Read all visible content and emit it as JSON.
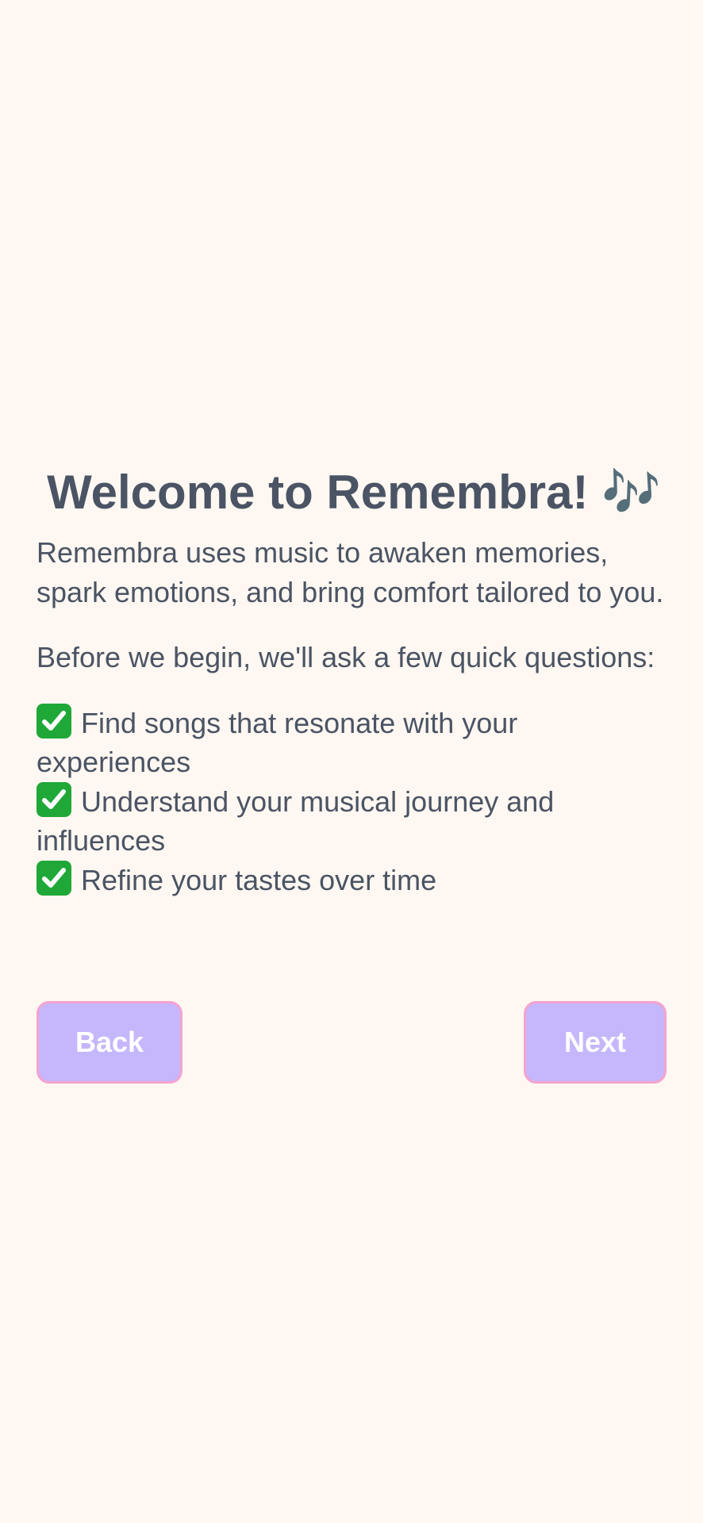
{
  "welcome": {
    "title": "Welcome to Remembra! 🎶",
    "intro": "Remembra uses music to awaken memories, spark emotions, and bring comfort tailored to you.",
    "question_prompt": "Before we begin, we'll ask a few quick questions:",
    "features": [
      {
        "icon": "check-mark-icon",
        "text": "Find songs that resonate with your experiences"
      },
      {
        "icon": "check-mark-icon",
        "text": "Understand your musical journey and influences"
      },
      {
        "icon": "check-mark-icon",
        "text": "Refine your tastes over time"
      }
    ]
  },
  "navigation": {
    "back_label": "Back",
    "next_label": "Next"
  },
  "colors": {
    "background": "#fff7f1",
    "text": "#4a5464",
    "button_fill": "#c6b6fb",
    "button_border": "#f4a3cf",
    "button_text": "#ffffff",
    "check_green": "#1fa838"
  }
}
